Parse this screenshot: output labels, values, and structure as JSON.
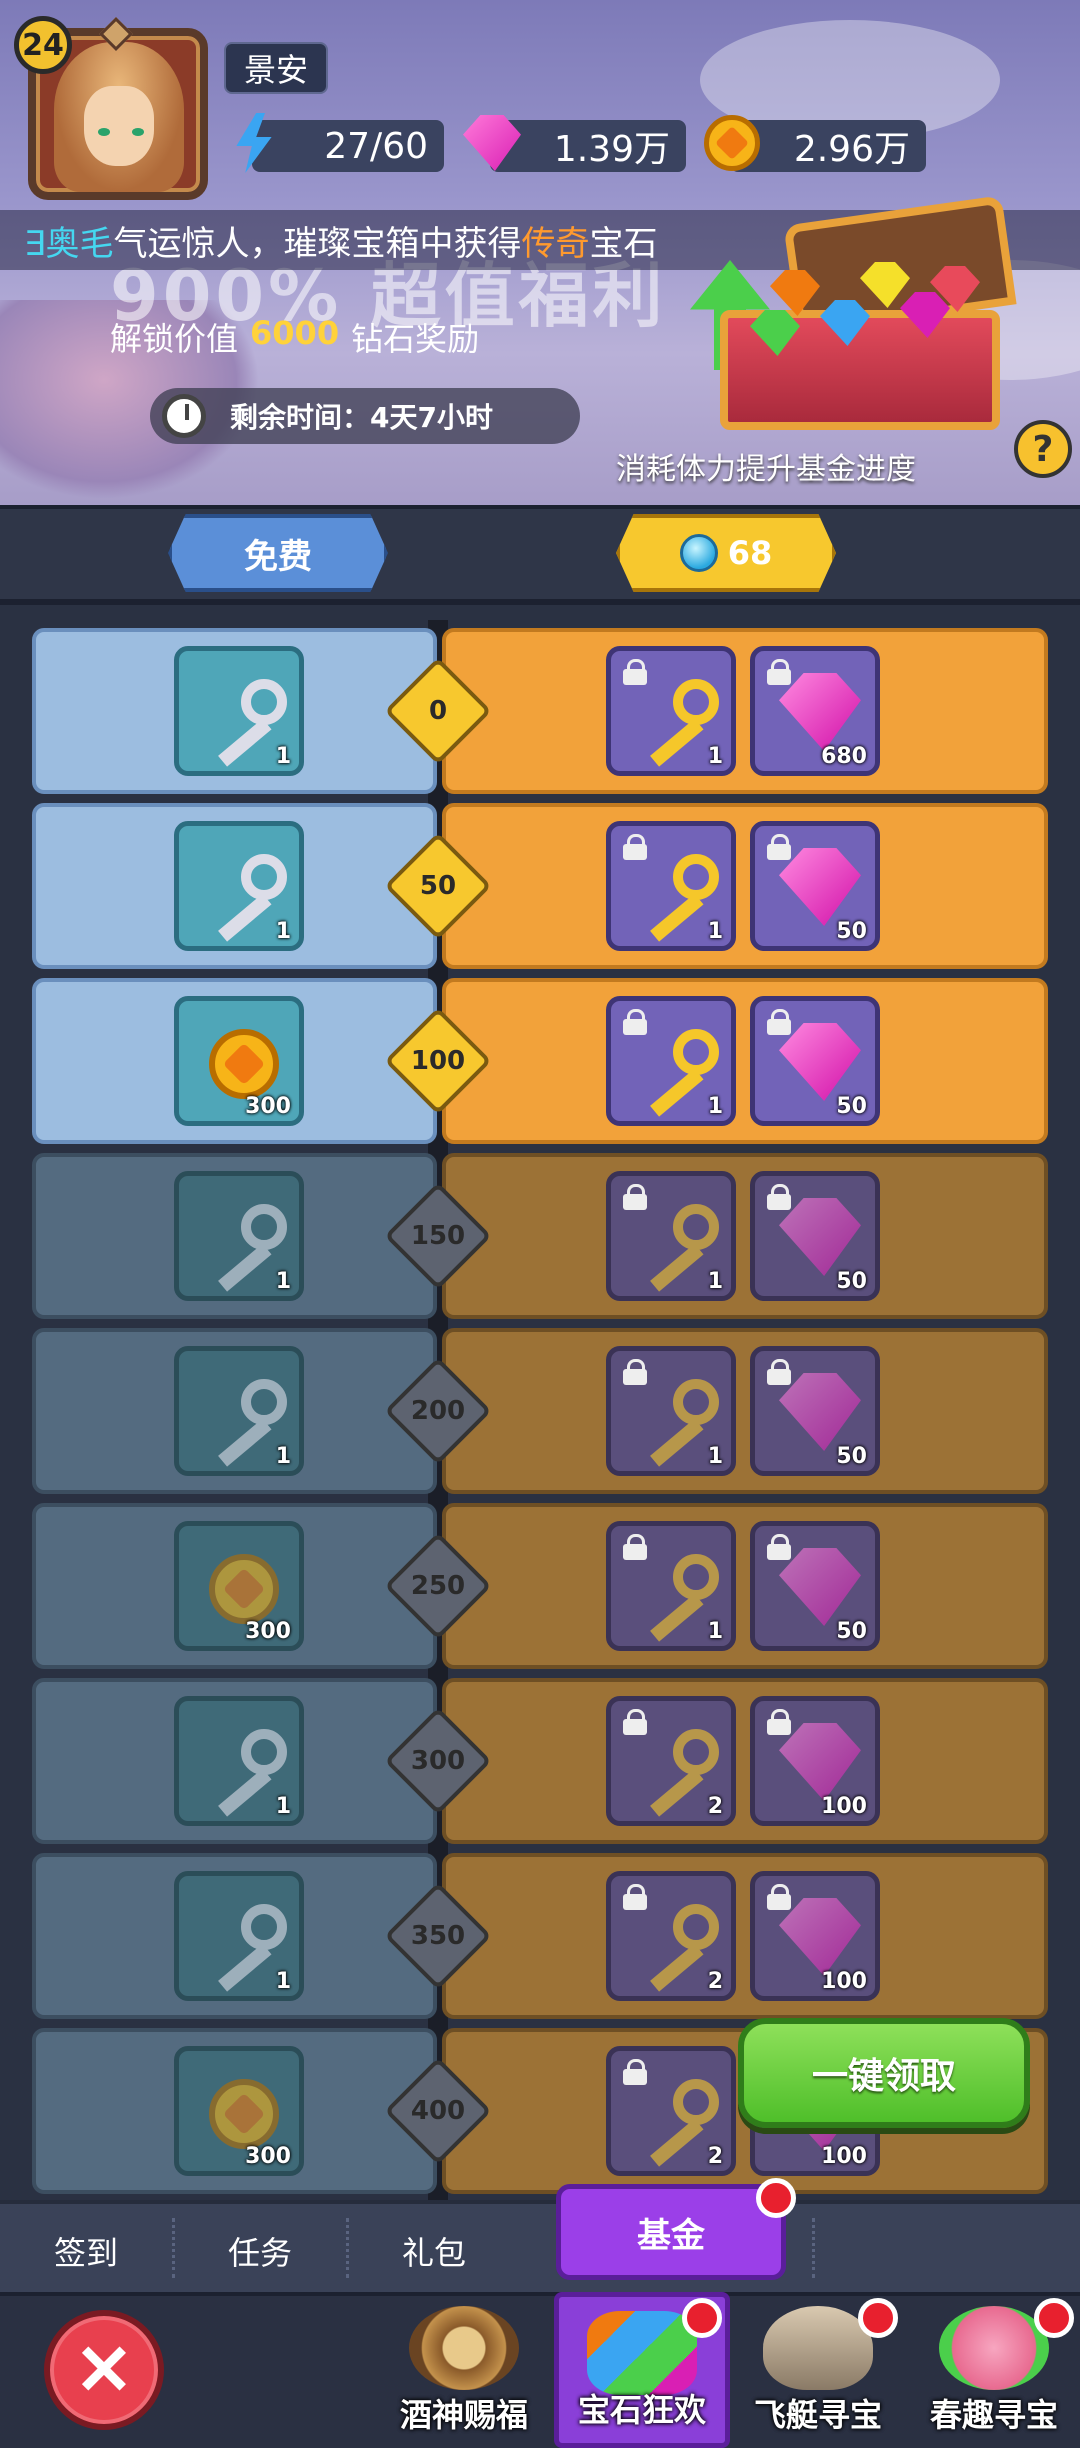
{
  "header": {
    "level": "24",
    "player_name": "景安",
    "energy": "27/60",
    "gems": "1.39万",
    "coins": "2.96万"
  },
  "ticker": {
    "prefix": "∃奥毛",
    "middle": "气运惊人，璀璨宝箱中获得",
    "highlight": "传奇",
    "suffix": "宝石"
  },
  "banner": {
    "title": "900% 超值福利",
    "unlock_prefix": "解锁价值",
    "unlock_value": "6000",
    "unlock_suffix": "钻石奖励",
    "timer": "剩余时间：4天7小时",
    "hint": "消耗体力提升基金进度",
    "help": "?"
  },
  "tracks": {
    "free_label": "免费",
    "paid_price": "68"
  },
  "rows": [
    {
      "milestone": "0",
      "free_icon": "silver-key",
      "free_count": "1",
      "paid_key_count": "1",
      "paid_gem_count": "680",
      "unlocked": true
    },
    {
      "milestone": "50",
      "free_icon": "silver-key",
      "free_count": "1",
      "paid_key_count": "1",
      "paid_gem_count": "50",
      "unlocked": true
    },
    {
      "milestone": "100",
      "free_icon": "coin",
      "free_count": "300",
      "paid_key_count": "1",
      "paid_gem_count": "50",
      "unlocked": true
    },
    {
      "milestone": "150",
      "free_icon": "silver-key",
      "free_count": "1",
      "paid_key_count": "1",
      "paid_gem_count": "50",
      "unlocked": false
    },
    {
      "milestone": "200",
      "free_icon": "silver-key",
      "free_count": "1",
      "paid_key_count": "1",
      "paid_gem_count": "50",
      "unlocked": false
    },
    {
      "milestone": "250",
      "free_icon": "coin",
      "free_count": "300",
      "paid_key_count": "1",
      "paid_gem_count": "50",
      "unlocked": false
    },
    {
      "milestone": "300",
      "free_icon": "silver-key",
      "free_count": "1",
      "paid_key_count": "2",
      "paid_gem_count": "100",
      "unlocked": false
    },
    {
      "milestone": "350",
      "free_icon": "silver-key",
      "free_count": "1",
      "paid_key_count": "2",
      "paid_gem_count": "100",
      "unlocked": false
    },
    {
      "milestone": "400",
      "free_icon": "coin",
      "free_count": "300",
      "paid_key_count": "2",
      "paid_gem_count": "100",
      "unlocked": false
    }
  ],
  "claim_all": "一键领取",
  "subnav": {
    "signin": "签到",
    "tasks": "任务",
    "gifts": "礼包",
    "fund": "基金"
  },
  "bottom_nav": [
    {
      "label": "酒神赐福",
      "icon": "wheel-icon",
      "badge": false,
      "active": false
    },
    {
      "label": "宝石狂欢",
      "icon": "gems-icon",
      "badge": true,
      "active": true
    },
    {
      "label": "飞艇寻宝",
      "icon": "airship-icon",
      "badge": true,
      "active": false
    },
    {
      "label": "春趣寻宝",
      "icon": "rose-icon",
      "badge": true,
      "active": false
    }
  ],
  "colors": {
    "free_track": "#9cbde0",
    "paid_track": "#f2a23a",
    "accent_purple": "#9b3fe8",
    "claim_green": "#4fbf2a"
  }
}
